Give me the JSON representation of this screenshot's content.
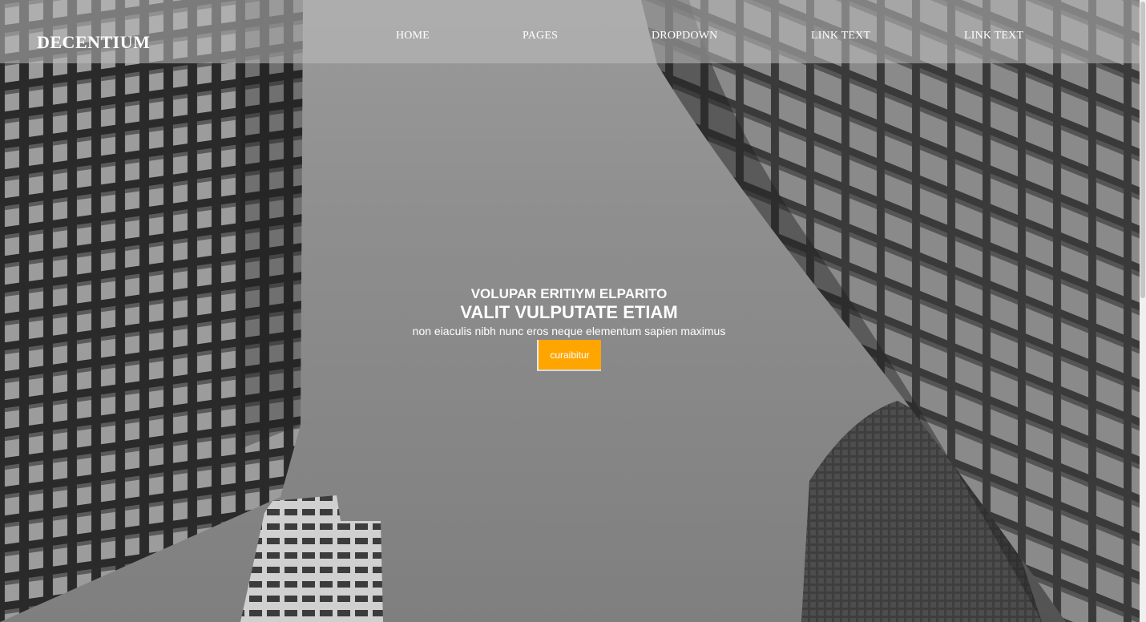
{
  "brand": {
    "name": "DECENTIUM"
  },
  "nav": {
    "items": [
      {
        "label": "HOME"
      },
      {
        "label": "PAGES"
      },
      {
        "label": "DROPDOWN"
      },
      {
        "label": "LINK TEXT"
      },
      {
        "label": "LINK TEXT"
      }
    ]
  },
  "hero": {
    "kicker": "VOLUPAR ERITIYM ELPARITO",
    "headline": "VALIT VULPUTATE ETIAM",
    "subtext": "non eiaculis nibh nunc eros neque elementum sapien maximus",
    "cta_label": "curaibitur"
  },
  "colors": {
    "accent": "#ffa500",
    "nav_overlay": "rgba(190,190,190,0.55)"
  }
}
